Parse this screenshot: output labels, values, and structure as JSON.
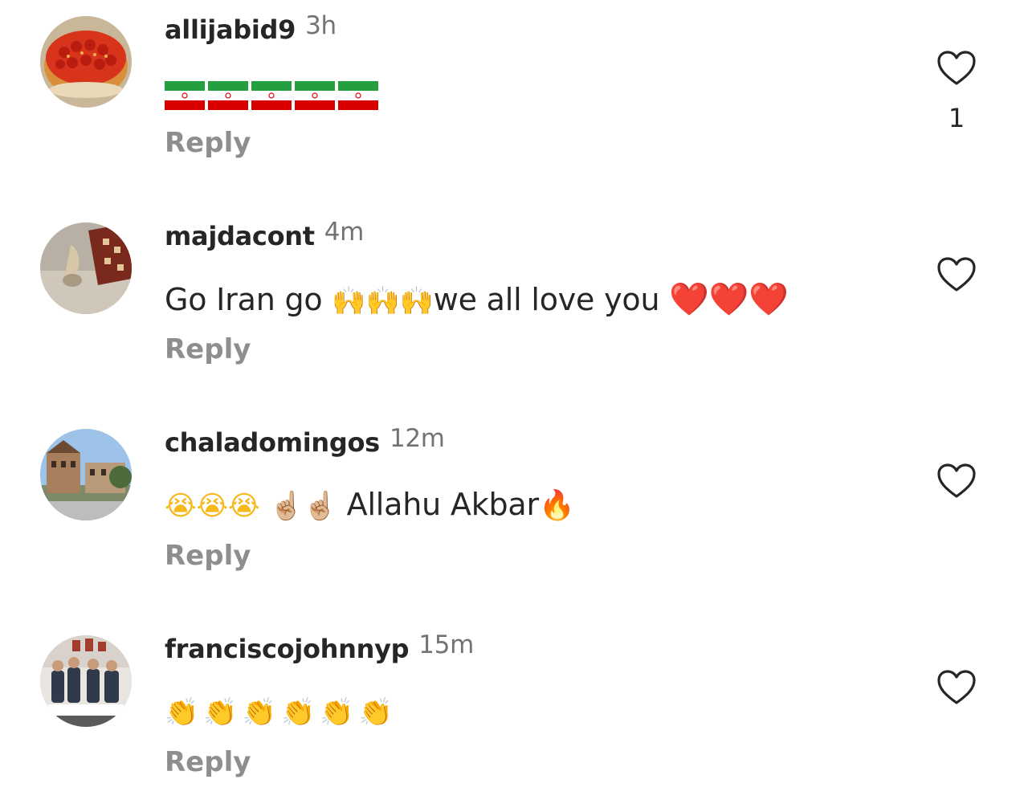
{
  "comments": [
    {
      "username": "allijabid9",
      "time": "3h",
      "text": "🇮🇷🇮🇷🇮🇷🇮🇷🇮🇷",
      "reply_label": "Reply",
      "like_count": "1",
      "avatar_icon": "strawberry-cake-icon"
    },
    {
      "username": "majdacont",
      "time": "4m",
      "text_prefix": "Go Iran go",
      "emoji_raised_hands": "🙌🙌🙌",
      "text_mid": "we all love you",
      "emoji_hearts": "❤️❤️❤️",
      "reply_label": "Reply",
      "avatar_icon": "carpet-photo-icon"
    },
    {
      "username": "chaladomingos",
      "time": "12m",
      "emoji_crying": "😭😭😭",
      "emoji_pointing": "☝🏼☝🏼",
      "text": "Allahu Akbar",
      "emoji_fire": "🔥",
      "reply_label": "Reply",
      "avatar_icon": "building-photo-icon"
    },
    {
      "username": "franciscojohnnyp",
      "time": "15m",
      "emoji_clapping": "👏👏👏👏👏👏",
      "reply_label": "Reply",
      "avatar_icon": "family-photo-icon"
    }
  ],
  "colors": {
    "text": "#262626",
    "muted": "#737373",
    "reply": "#8e8e8e",
    "heart_red": "#e0202a",
    "hands_yellow": "#f6b81b"
  }
}
